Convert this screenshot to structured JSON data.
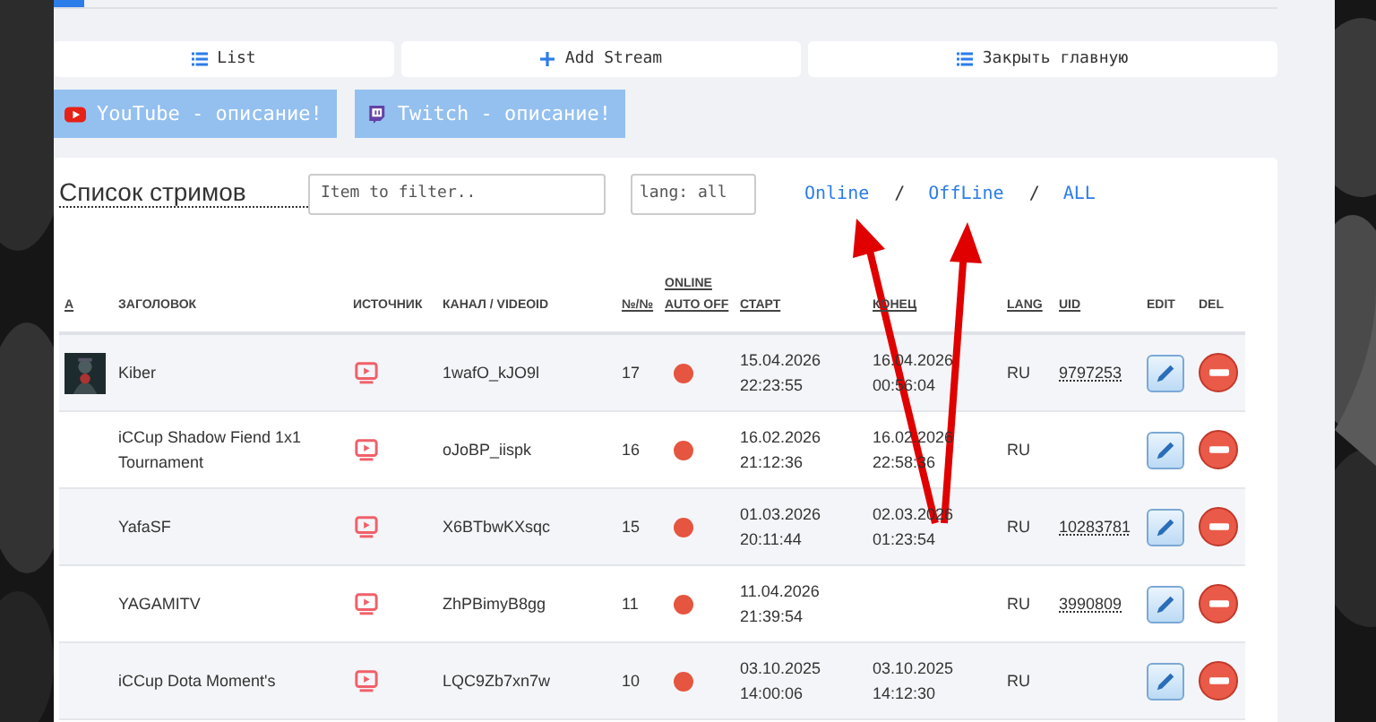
{
  "toolbar": [
    {
      "label": "List"
    },
    {
      "label": "Add Stream"
    },
    {
      "label": "Закрыть главную"
    }
  ],
  "descriptions": [
    {
      "label": "YouTube - описание!"
    },
    {
      "label": "Twitch - описание!"
    }
  ],
  "list": {
    "title": "Список стримов",
    "filter": {
      "placeholder": "Item to filter.."
    },
    "lang": {
      "placeholder": "lang: all"
    },
    "views": [
      {
        "label": "Online"
      },
      {
        "label": "/",
        "kind": "separator"
      },
      {
        "label": "OffLine"
      },
      {
        "label": "/",
        "kind": "separator"
      },
      {
        "label": "ALL"
      }
    ]
  },
  "table": {
    "columns": [
      {
        "label": "А",
        "sortable": true
      },
      {
        "label": "ЗАГОЛОВОК",
        "sortable": false
      },
      {
        "label": "ИСТОЧНИК",
        "sortable": false
      },
      {
        "label": "КАНАЛ / VIDEOID",
        "sortable": false
      },
      {
        "label": "№/№",
        "sortable": true
      },
      {
        "label": "ONLINE AUTO OFF",
        "sortable": true
      },
      {
        "label": "СТАРТ",
        "sortable": true
      },
      {
        "label": "КОНЕЦ",
        "sortable": true
      },
      {
        "label": "LANG",
        "sortable": true
      },
      {
        "label": "UID",
        "sortable": true
      },
      {
        "label": "EDIT",
        "sortable": false
      },
      {
        "label": "DEL",
        "sortable": false
      }
    ],
    "rows": [
      {
        "title": "Kiber",
        "channel": "1wafO_kJO9l",
        "number": "17",
        "online": false,
        "start": "15.04.2026 22:23:55",
        "end": "16.04.2026 00:56:04",
        "lang": "RU",
        "uid": "9797253"
      },
      {
        "title": "iCCup Shadow Fiend 1x1 Tournament",
        "channel": "oJoBP_iispk",
        "number": "16",
        "online": false,
        "start": "16.02.2026 21:12:36",
        "end": "16.02.2026 22:58:36",
        "lang": "RU"
      },
      {
        "title": "YafaSF",
        "channel": "X6BTbwKXsqc",
        "number": "15",
        "online": false,
        "start": "01.03.2026 20:11:44",
        "end": "02.03.2026 01:23:54",
        "lang": "RU",
        "uid": "10283781"
      },
      {
        "title": "YAGAMITV",
        "channel": "ZhPBimyB8gg",
        "number": "11",
        "online": false,
        "start": "11.04.2026 21:39:54",
        "lang": "RU",
        "uid": "3990809"
      },
      {
        "title": "iCCup Dota Moment's",
        "channel": "LQC9Zb7xn7w",
        "number": "10",
        "online": false,
        "start": "03.10.2025 14:00:06",
        "end": "03.10.2025 14:12:30",
        "lang": "RU"
      }
    ]
  }
}
